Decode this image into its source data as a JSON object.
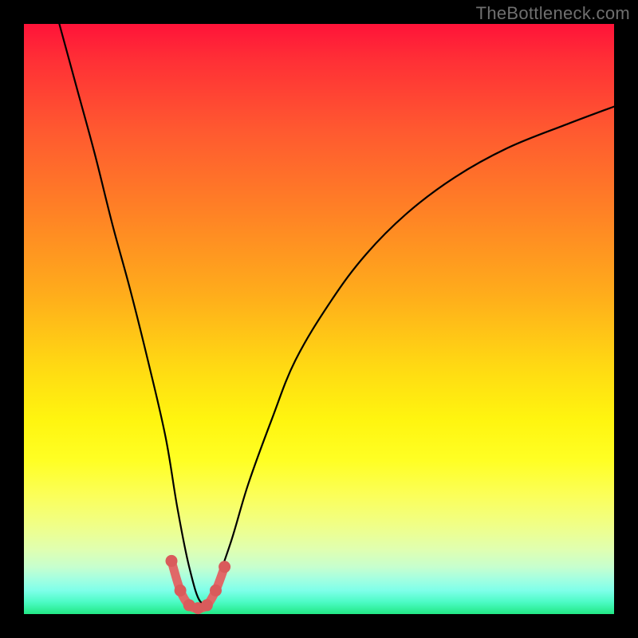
{
  "watermark": "TheBottleneck.com",
  "colors": {
    "frame": "#000000",
    "gradient_top": "#ff1339",
    "gradient_bottom": "#22e885",
    "curve_stroke": "#000000",
    "marker_stroke": "#e06868",
    "marker_dot": "#d95b5b"
  },
  "chart_data": {
    "type": "line",
    "title": "",
    "xlabel": "",
    "ylabel": "",
    "xlim": [
      0,
      100
    ],
    "ylim": [
      0,
      100
    ],
    "grid": false,
    "annotations": [
      "TheBottleneck.com"
    ],
    "series": [
      {
        "name": "bottleneck-curve",
        "x": [
          6,
          9,
          12,
          15,
          18,
          21,
          24,
          26,
          28,
          30,
          32,
          35,
          38,
          42,
          46,
          52,
          58,
          65,
          73,
          82,
          92,
          100
        ],
        "y": [
          100,
          89,
          78,
          66,
          55,
          43,
          30,
          18,
          8,
          2,
          4,
          12,
          22,
          33,
          43,
          53,
          61,
          68,
          74,
          79,
          83,
          86
        ]
      },
      {
        "name": "optimal-marker",
        "x": [
          25,
          26.5,
          28,
          29.5,
          31,
          32.5,
          34
        ],
        "y": [
          9,
          4,
          1.5,
          1,
          1.5,
          4,
          8
        ]
      }
    ],
    "background": "vertical-gradient-red-to-green",
    "notes": "The V-shaped curve reaches its minimum (near zero) around x≈29–30; left branch rises steeply to top-left corner, right branch rises asymptotically toward x=100. The pink marker highlights the valley of the curve."
  }
}
